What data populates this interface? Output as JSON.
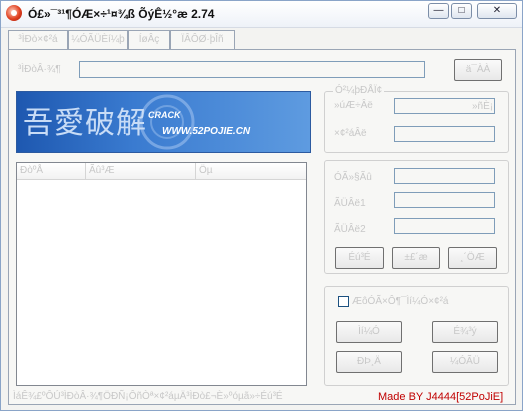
{
  "window": {
    "title": "Ó£»¯³¹¶ÓÆ×÷¹¤¾ß ÕýÊ½°æ 2.74",
    "min_glyph": "—",
    "max_glyph": "□",
    "close_glyph": "✕"
  },
  "tabs": [
    "³ÌÐò×¢²á",
    "¼ÓÃÜÈí¼þ",
    "ÍøÂç",
    "ÏÂÔØ·þÎñ"
  ],
  "top": {
    "path_label": "³ÌÐòÂ·¾¶",
    "path_value": "",
    "browse_button": "ä¯ÀÀ"
  },
  "banner": {
    "chinese": "吾愛破解",
    "crack": "CRACK",
    "site": "WWW.52POJIE.CN"
  },
  "list": {
    "columns": [
      "ÐòºÅ",
      "Ãû³Æ",
      "Öµ"
    ]
  },
  "group1": {
    "title": "Ó²¼þÐÅÏ¢",
    "rows": [
      {
        "label": "»úÆ÷Âë",
        "suffix": "»ñÈ¡"
      },
      {
        "label": "×¢²áÂë",
        "suffix": ""
      }
    ]
  },
  "group2": {
    "rows": [
      {
        "label": "ÓÃ»§Ãû"
      },
      {
        "label": "ÃÜÂë1"
      },
      {
        "label": "ÃÜÂë2"
      }
    ],
    "buttons": [
      "Éú³É",
      "±£´æ",
      "¸´ÖÆ"
    ]
  },
  "group3": {
    "checkbox_label": "ÆôÓÃ×Ô¶¯Ìí¼Ó×¢²á",
    "buttons": [
      "Ìí¼Ó",
      "É¾³ý",
      "ÐÞ¸Ä",
      "¼ÓÃÜ"
    ]
  },
  "footer": {
    "status": "ÌáÊ¾£ºÔÚ³ÌÐòÂ·¾¶ÖÐÑ¡ÔñÒª×¢²áµÄ³ÌÐò£¬È»ºóµã»÷Éú³É",
    "credit": "Made BY J4444[52PoJiE]"
  },
  "colors": {
    "credit": "#c00000",
    "banner": "#2c5aa0"
  }
}
